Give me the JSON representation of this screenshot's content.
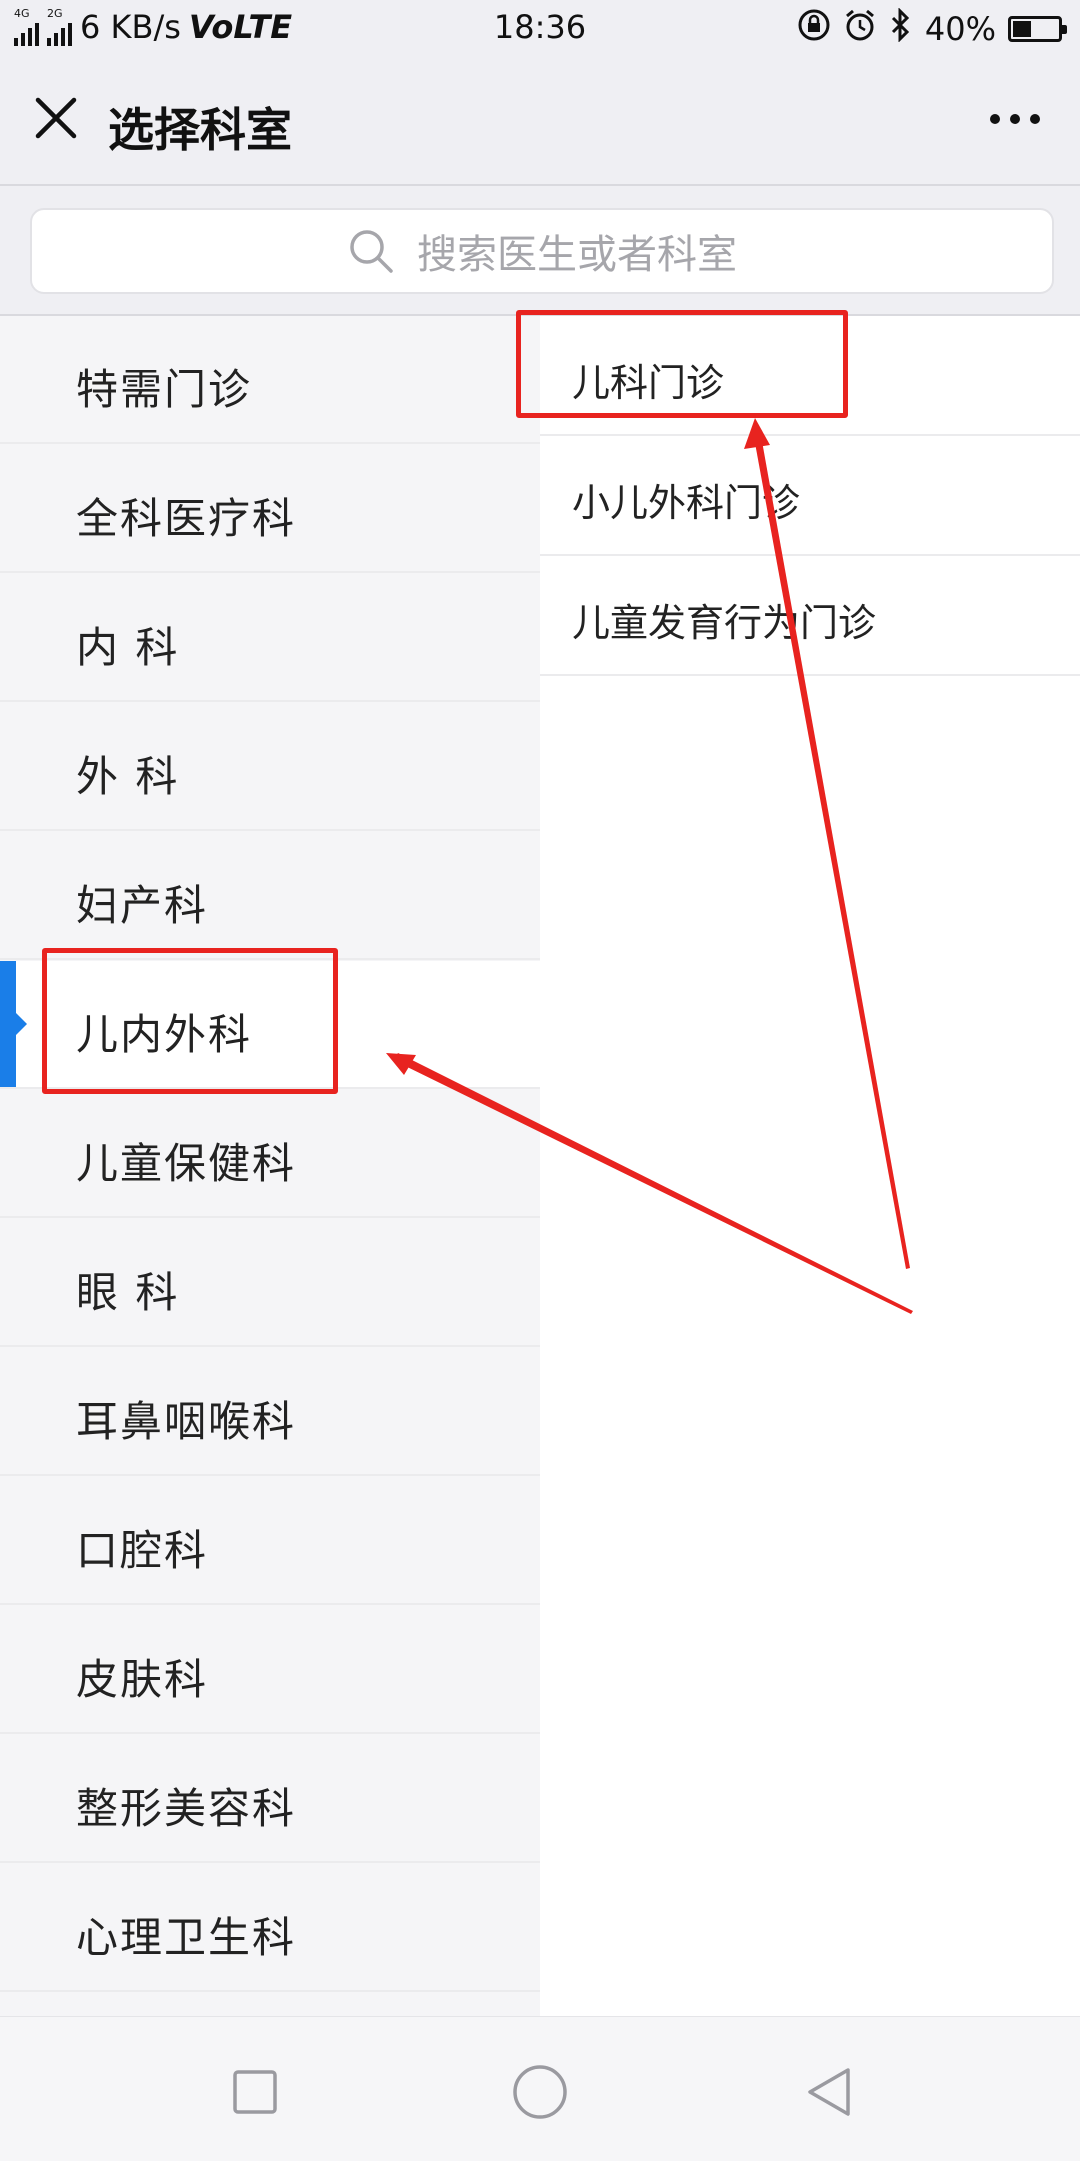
{
  "status_bar": {
    "net_tag_1": "4G",
    "net_tag_2": "2G",
    "speed": "6 KB/s",
    "volte": "VoLTE",
    "time": "18:36",
    "battery": "40%",
    "battery_level": 0.4
  },
  "header": {
    "title": "选择科室",
    "close_icon": "close-icon",
    "more_icon": "more-icon"
  },
  "search": {
    "placeholder": "搜索医生或者科室",
    "icon": "search-icon"
  },
  "departments": [
    {
      "label": "特需门诊"
    },
    {
      "label": "全科医疗科"
    },
    {
      "label": "内 科"
    },
    {
      "label": "外 科"
    },
    {
      "label": "妇产科"
    },
    {
      "label": "儿内外科",
      "selected": true
    },
    {
      "label": "儿童保健科"
    },
    {
      "label": "眼 科"
    },
    {
      "label": "耳鼻咽喉科"
    },
    {
      "label": "口腔科"
    },
    {
      "label": "皮肤科"
    },
    {
      "label": "整形美容科"
    },
    {
      "label": "心理卫生科"
    }
  ],
  "sub_departments": [
    {
      "label": "儿科门诊"
    },
    {
      "label": "小儿外科门诊"
    },
    {
      "label": "儿童发育行为门诊"
    }
  ],
  "nav_bar": {
    "recent_icon": "square-icon",
    "home_icon": "circle-icon",
    "back_icon": "triangle-back-icon"
  },
  "colors": {
    "accent": "#1a7ee8",
    "annotation": "#e8231f"
  }
}
